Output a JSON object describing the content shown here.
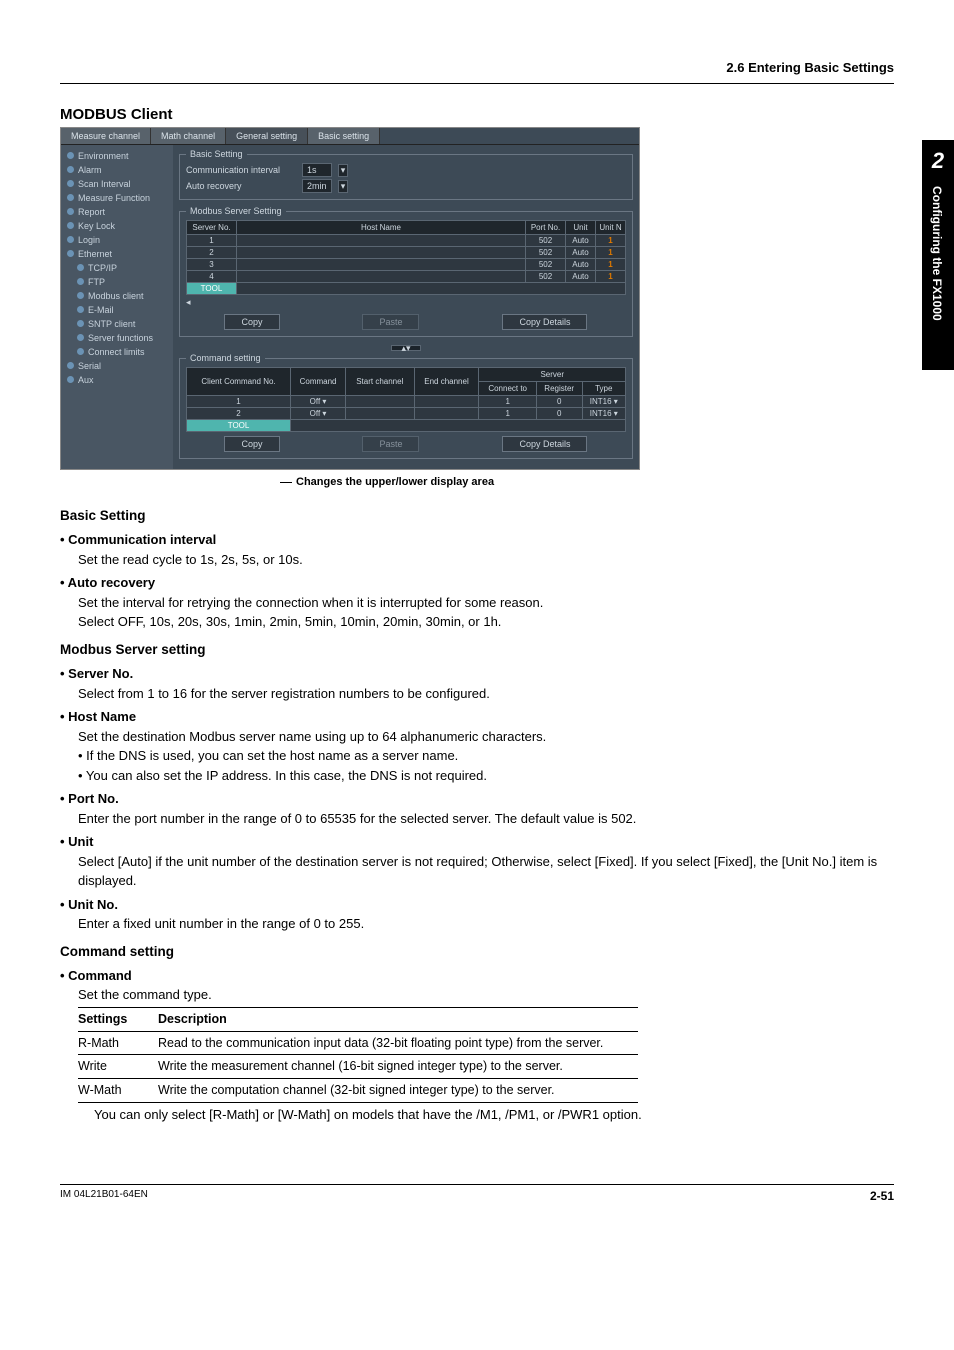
{
  "header": {
    "section_ref": "2.6  Entering Basic Settings"
  },
  "sidetab": {
    "chapter": "2",
    "title": "Configuring the FX1000"
  },
  "title_main": "MODBUS Client",
  "screenshot": {
    "tabs": {
      "t1": "Measure channel",
      "t2": "Math channel",
      "t3": "General setting",
      "t4": "Basic setting"
    },
    "sidebar": {
      "i0": "Environment",
      "i1": "Alarm",
      "i2": "Scan Interval",
      "i3": "Measure Function",
      "i4": "Report",
      "i5": "Key Lock",
      "i6": "Login",
      "i7": "Ethernet",
      "i7a": "TCP/IP",
      "i7b": "FTP",
      "i7c": "Modbus client",
      "i7d": "E-Mail",
      "i7e": "SNTP client",
      "i7f": "Server functions",
      "i7g": "Connect limits",
      "i8": "Serial",
      "i9": "Aux"
    },
    "basic_grp": {
      "legend": "Basic Setting",
      "comm_label": "Communication interval",
      "comm_val": "1s",
      "auto_label": "Auto recovery",
      "auto_val": "2min"
    },
    "server_grp": {
      "legend": "Modbus Server Setting",
      "col_no": "Server No.",
      "col_host": "Host Name",
      "col_port": "Port No.",
      "col_unit": "Unit",
      "col_unitn": "Unit N",
      "rows": [
        {
          "no": "1",
          "port": "502",
          "unit": "Auto",
          "un": "1"
        },
        {
          "no": "2",
          "port": "502",
          "unit": "Auto",
          "un": "1"
        },
        {
          "no": "3",
          "port": "502",
          "unit": "Auto",
          "un": "1"
        },
        {
          "no": "4",
          "port": "502",
          "unit": "Auto",
          "un": "1"
        }
      ],
      "tool": "TOOL",
      "btn_copy": "Copy",
      "btn_paste": "Paste",
      "btn_copyd": "Copy Details"
    },
    "cmd_grp": {
      "legend": "Command setting",
      "col_no": "Client Command No.",
      "col_cmd": "Command",
      "col_start": "Start channel",
      "col_end": "End channel",
      "col_server": "Server",
      "col_conn": "Connect to",
      "col_reg": "Register",
      "col_type": "Type",
      "rows": [
        {
          "no": "1",
          "cmd": "Off",
          "conn": "1",
          "reg": "0",
          "type": "INT16"
        },
        {
          "no": "2",
          "cmd": "Off",
          "conn": "1",
          "reg": "0",
          "type": "INT16"
        }
      ],
      "tool": "TOOL",
      "btn_copy": "Copy",
      "btn_paste": "Paste",
      "btn_copyd": "Copy Details"
    }
  },
  "caption": "Changes the upper/lower display area",
  "body": {
    "h_basic": "Basic Setting",
    "b_comm_h": "• Communication interval",
    "b_comm_t": "Set the read cycle to 1s, 2s, 5s, or 10s.",
    "b_auto_h": "• Auto recovery",
    "b_auto_t1": "Set the interval for retrying the connection when it is interrupted for some reason.",
    "b_auto_t2": "Select OFF, 10s, 20s, 30s, 1min, 2min, 5min, 10min, 20min, 30min, or 1h.",
    "h_server": "Modbus Server setting",
    "s_no_h": "• Server No.",
    "s_no_t": "Select from 1 to 16 for the server registration numbers to be configured.",
    "s_host_h": "• Host Name",
    "s_host_t": "Set the destination Modbus server name using up to 64 alphanumeric characters.",
    "s_host_s1": "•  If the DNS is used, you can set the host name as a server name.",
    "s_host_s2": "•  You can also set the IP address.  In this case, the DNS is not required.",
    "s_port_h": "• Port No.",
    "s_port_t": "Enter the port number in the range of 0 to 65535 for the selected server.  The default value is 502.",
    "s_unit_h": "• Unit",
    "s_unit_t": "Select [Auto] if the unit number of the destination server is not required; Otherwise, select [Fixed].  If you select [Fixed], the [Unit No.] item is displayed.",
    "s_unitn_h": "• Unit No.",
    "s_unitn_t": "Enter a fixed unit number in the range of 0 to 255.",
    "h_cmd": "Command setting",
    "c_cmd_h": "• Command",
    "c_cmd_t": "Set the command type.",
    "tbl": {
      "h1": "Settings",
      "h2": "Description",
      "r1a": "R-Math",
      "r1b": "Read to the communication input data (32-bit floating point type) from the server.",
      "r2a": "Write",
      "r2b": "Write the measurement channel (16-bit signed integer type) to the server.",
      "r3a": "W-Math",
      "r3b": "Write the computation channel (32-bit signed integer type) to the server."
    },
    "note": "You can only select [R-Math] or [W-Math] on models that have the /M1, /PM1, or /PWR1 option."
  },
  "footer": {
    "doc": "IM 04L21B01-64EN",
    "page": "2-51"
  }
}
